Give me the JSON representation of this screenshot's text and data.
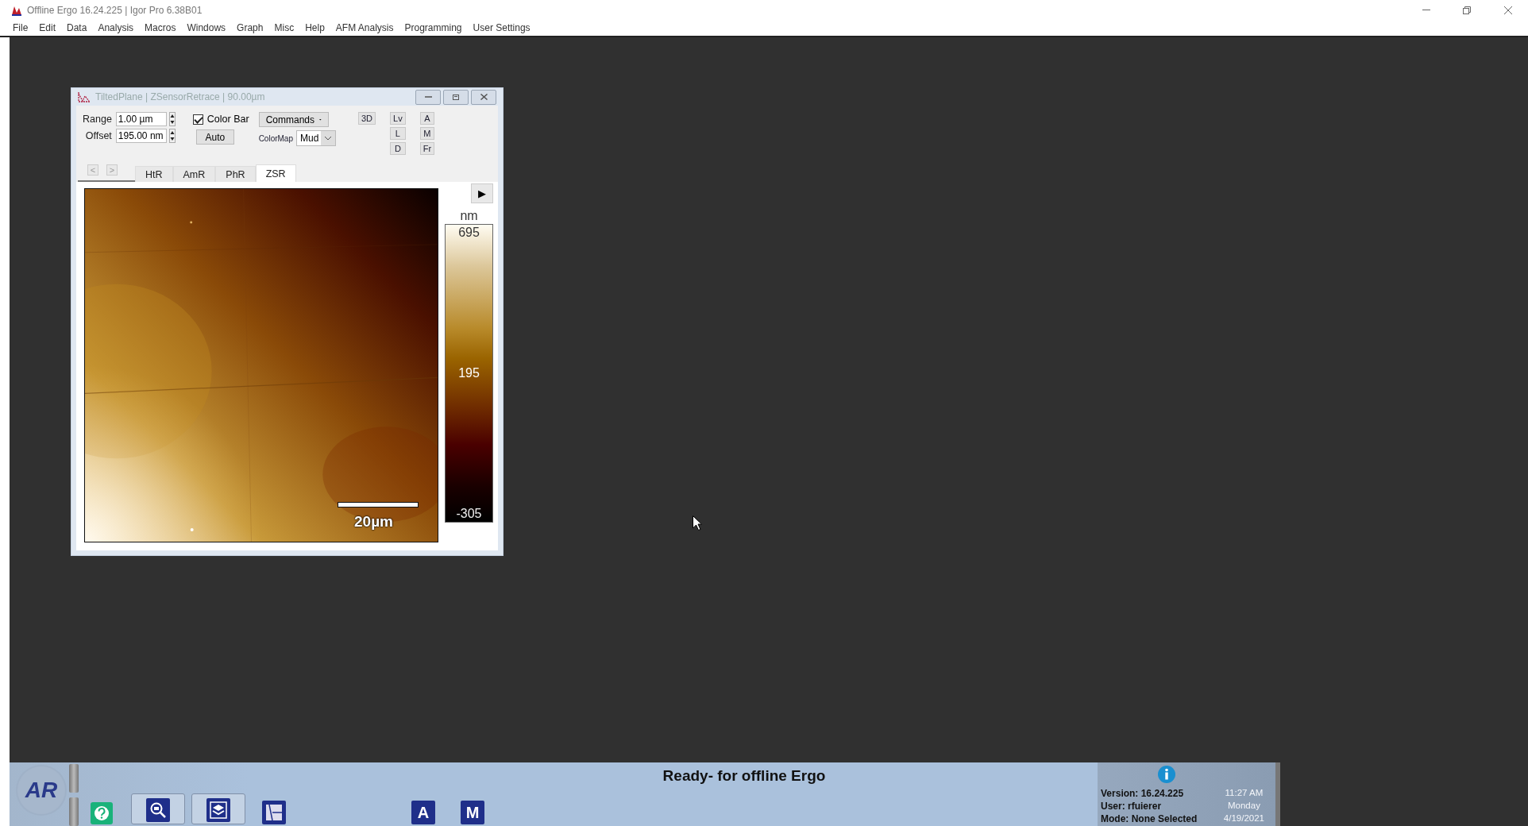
{
  "window": {
    "title": "Offline Ergo 16.24.225 | Igor Pro 6.38B01"
  },
  "menu": [
    "File",
    "Edit",
    "Data",
    "Analysis",
    "Macros",
    "Windows",
    "Graph",
    "Misc",
    "Help",
    "AFM Analysis",
    "Programming",
    "User Settings"
  ],
  "image_window": {
    "title": "TiltedPlane | ZSensorRetrace | 90.00µm",
    "range": {
      "label": "Range",
      "value": "1.00 µm"
    },
    "offset": {
      "label": "Offset",
      "value": "195.00 nm"
    },
    "color_bar": {
      "label": "Color Bar",
      "checked": true
    },
    "commands": "Commands",
    "auto": "Auto",
    "colormap": {
      "label": "ColorMap",
      "value": "Mud"
    },
    "view_button": "3D",
    "button_columns": [
      [
        "Lv",
        "L",
        "D"
      ],
      [
        "A",
        "M",
        "Fr"
      ]
    ],
    "nav": [
      {
        "label": "<",
        "disabled": true
      },
      {
        "label": ">",
        "disabled": true
      }
    ],
    "tabs": [
      {
        "label": "HtR",
        "selected": false
      },
      {
        "label": "AmR",
        "selected": false
      },
      {
        "label": "PhR",
        "selected": false
      },
      {
        "label": "ZSR",
        "selected": true
      }
    ],
    "play": "▶",
    "image": {
      "kind": "picture",
      "scale_bar": "20µm"
    },
    "colorbar": {
      "unit": "nm",
      "ticks": [
        "695",
        "195",
        "-305"
      ]
    }
  },
  "status_bar": {
    "logo": "AR",
    "tool_buttons": [
      "A",
      "M"
    ],
    "message": "Ready- for offline Ergo",
    "info": [
      "Version: 16.24.225",
      "User: rfuierer",
      "Mode: None Selected"
    ],
    "clock": [
      "11:27 AM",
      "Monday",
      "4/19/2021"
    ]
  }
}
